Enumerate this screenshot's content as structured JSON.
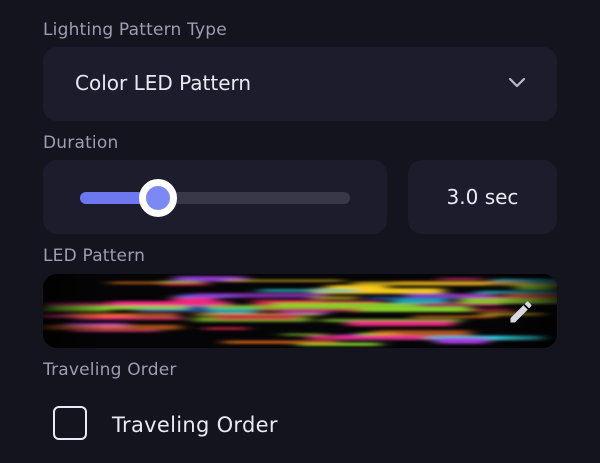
{
  "pattern_type": {
    "label": "Lighting Pattern Type",
    "selected": "Color LED Pattern",
    "icon": "chevron-down-icon"
  },
  "duration": {
    "label": "Duration",
    "slider_fraction": 0.29,
    "value_text": "3.0 sec"
  },
  "led_pattern": {
    "label": "LED Pattern",
    "edit_icon": "pencil-icon",
    "colors": [
      "#e8244f",
      "#ff2d8a",
      "#ffd21a",
      "#8bd62a",
      "#20c8d8",
      "#2a6cf0",
      "#a63ae0",
      "#ff7a1a"
    ]
  },
  "traveling_order": {
    "label": "Traveling Order",
    "checkbox_label": "Traveling Order",
    "checked": false
  },
  "colors": {
    "background": "#14141f",
    "card": "#1c1c2c",
    "accent": "#6d78f0",
    "muted_text": "#9d9db3",
    "text": "#e9e9f2"
  }
}
